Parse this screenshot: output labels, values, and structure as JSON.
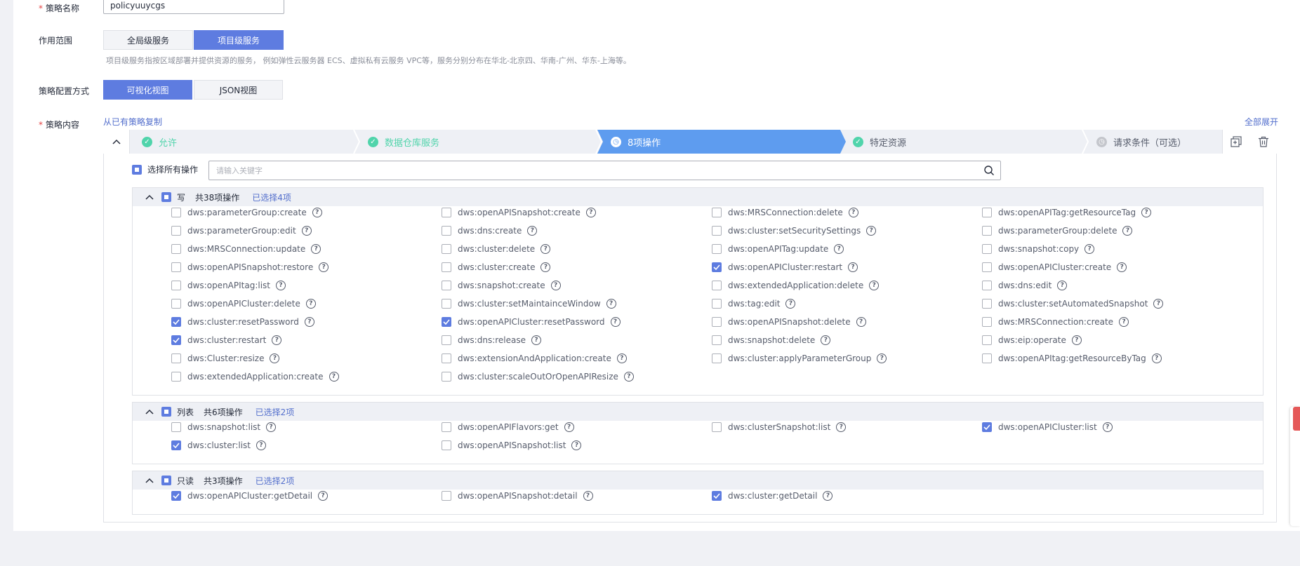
{
  "form": {
    "name_label": "策略名称",
    "name_value": "policyuuycgs",
    "scope_label": "作用范围",
    "scope_options": [
      "全局级服务",
      "项目级服务"
    ],
    "scope_hint": "项目级服务指按区域部署并提供资源的服务， 例如弹性云服务器 ECS、虚拟私有云服务 VPC等，服务分别分布在华北-北京四、华南-广州、华东-上海等。",
    "mode_label": "策略配置方式",
    "mode_options": [
      "可视化视图",
      "JSON视图"
    ],
    "content_label": "策略内容",
    "copy_link": "从已有策略复制",
    "expand_all": "全部展开"
  },
  "steps": [
    "允许",
    "数据仓库服务",
    "8项操作",
    "特定资源",
    "请求条件（可选）"
  ],
  "select_all_label": "选择所有操作",
  "search_placeholder": "请输入关键字",
  "groups": [
    {
      "name": "写",
      "count": "共38项操作",
      "selected": "已选择4项",
      "items": [
        {
          "label": "dws:parameterGroup:create",
          "checked": false
        },
        {
          "label": "dws:openAPISnapshot:create",
          "checked": false
        },
        {
          "label": "dws:MRSConnection:delete",
          "checked": false
        },
        {
          "label": "dws:openAPITag:getResourceTag",
          "checked": false
        },
        {
          "label": "dws:parameterGroup:edit",
          "checked": false
        },
        {
          "label": "dws:dns:create",
          "checked": false
        },
        {
          "label": "dws:cluster:setSecuritySettings",
          "checked": false
        },
        {
          "label": "dws:parameterGroup:delete",
          "checked": false
        },
        {
          "label": "dws:MRSConnection:update",
          "checked": false
        },
        {
          "label": "dws:cluster:delete",
          "checked": false
        },
        {
          "label": "dws:openAPITag:update",
          "checked": false
        },
        {
          "label": "dws:snapshot:copy",
          "checked": false
        },
        {
          "label": "dws:openAPISnapshot:restore",
          "checked": false
        },
        {
          "label": "dws:cluster:create",
          "checked": false
        },
        {
          "label": "dws:openAPICluster:restart",
          "checked": true
        },
        {
          "label": "dws:openAPICluster:create",
          "checked": false
        },
        {
          "label": "dws:openAPItag:list",
          "checked": false
        },
        {
          "label": "dws:snapshot:create",
          "checked": false
        },
        {
          "label": "dws:extendedApplication:delete",
          "checked": false
        },
        {
          "label": "dws:dns:edit",
          "checked": false
        },
        {
          "label": "dws:openAPICluster:delete",
          "checked": false
        },
        {
          "label": "dws:cluster:setMaintainceWindow",
          "checked": false
        },
        {
          "label": "dws:tag:edit",
          "checked": false
        },
        {
          "label": "dws:cluster:setAutomatedSnapshot",
          "checked": false
        },
        {
          "label": "dws:cluster:resetPassword",
          "checked": true
        },
        {
          "label": "dws:openAPICluster:resetPassword",
          "checked": true
        },
        {
          "label": "dws:openAPISnapshot:delete",
          "checked": false
        },
        {
          "label": "dws:MRSConnection:create",
          "checked": false
        },
        {
          "label": "dws:cluster:restart",
          "checked": true
        },
        {
          "label": "dws:dns:release",
          "checked": false
        },
        {
          "label": "dws:snapshot:delete",
          "checked": false
        },
        {
          "label": "dws:eip:operate",
          "checked": false
        },
        {
          "label": "dws:Cluster:resize",
          "checked": false
        },
        {
          "label": "dws:extensionAndApplication:create",
          "checked": false
        },
        {
          "label": "dws:cluster:applyParameterGroup",
          "checked": false
        },
        {
          "label": "dws:openAPItag:getResourceByTag",
          "checked": false
        },
        {
          "label": "dws:extendedApplication:create",
          "checked": false
        },
        {
          "label": "dws:cluster:scaleOutOrOpenAPIResize",
          "checked": false
        }
      ]
    },
    {
      "name": "列表",
      "count": "共6项操作",
      "selected": "已选择2项",
      "items": [
        {
          "label": "dws:snapshot:list",
          "checked": false
        },
        {
          "label": "dws:openAPIFlavors:get",
          "checked": false
        },
        {
          "label": "dws:clusterSnapshot:list",
          "checked": false
        },
        {
          "label": "dws:openAPICluster:list",
          "checked": true
        },
        {
          "label": "dws:cluster:list",
          "checked": true
        },
        {
          "label": "dws:openAPISnapshot:list",
          "checked": false
        }
      ]
    },
    {
      "name": "只读",
      "count": "共3项操作",
      "selected": "已选择2项",
      "items": [
        {
          "label": "dws:openAPICluster:getDetail",
          "checked": true
        },
        {
          "label": "dws:openAPISnapshot:detail",
          "checked": false
        },
        {
          "label": "dws:cluster:getDetail",
          "checked": true
        }
      ]
    }
  ],
  "colors": {
    "accent": "#5e7ce0",
    "step_active": "#5e9cef",
    "success": "#50d4ab",
    "required": "#e54545"
  }
}
